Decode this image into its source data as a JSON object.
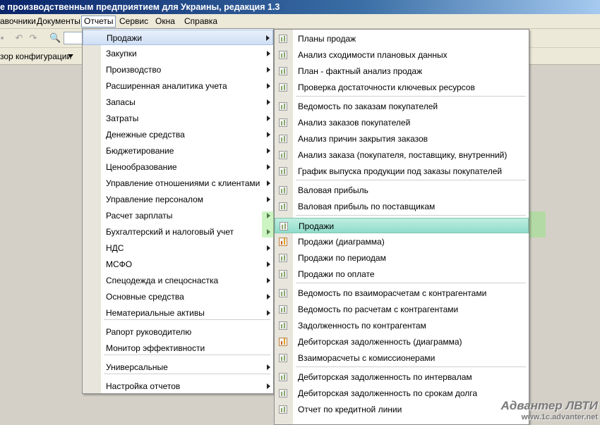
{
  "window": {
    "title": "е производственным предприятием для Украины, редакция 1.3"
  },
  "menubar": {
    "items": [
      "авочники",
      "Документы",
      "Отчеты",
      "Сервис",
      "Окна",
      "Справка"
    ],
    "active": "Отчеты"
  },
  "configbar": {
    "label": "зор конфигурации"
  },
  "reports_menu": {
    "items": [
      {
        "label": "Продажи",
        "submenu": true,
        "highlighted": true
      },
      {
        "label": "Закупки",
        "submenu": true
      },
      {
        "label": "Производство",
        "submenu": true
      },
      {
        "label": "Расширенная аналитика учета",
        "submenu": true
      },
      {
        "label": "Запасы",
        "submenu": true
      },
      {
        "label": "Затраты",
        "submenu": true
      },
      {
        "label": "Денежные средства",
        "submenu": true
      },
      {
        "label": "Бюджетирование",
        "submenu": true
      },
      {
        "label": "Ценообразование",
        "submenu": true
      },
      {
        "label": "Управление отношениями с клиентами",
        "submenu": true
      },
      {
        "label": "Управление персоналом",
        "submenu": true
      },
      {
        "label": "Расчет зарплаты",
        "submenu": true
      },
      {
        "label": "Бухгалтерский и налоговый учет",
        "submenu": true
      },
      {
        "label": "НДС",
        "submenu": true
      },
      {
        "label": "МСФО",
        "submenu": true
      },
      {
        "label": "Спецодежда и спецоснастка",
        "submenu": true
      },
      {
        "label": "Основные средства",
        "submenu": true
      },
      {
        "label": "Нематериальные активы",
        "submenu": true
      },
      {
        "label": "Рапорт руководителю",
        "submenu": false
      },
      {
        "label": "Монитор эффективности",
        "submenu": false
      },
      {
        "label": "Универсальные",
        "submenu": true
      },
      {
        "label": "Настройка отчетов",
        "submenu": true
      }
    ]
  },
  "sales_submenu": {
    "items": [
      {
        "label": "Планы продаж",
        "icon": "report-icon"
      },
      {
        "label": "Анализ сходимости плановых данных",
        "icon": "report-icon"
      },
      {
        "label": "План - фактный анализ продаж",
        "icon": "report-icon"
      },
      {
        "label": "Проверка достаточности ключевых ресурсов",
        "icon": "report-icon"
      },
      {
        "label": "Ведомость по заказам покупателей",
        "icon": "report-icon"
      },
      {
        "label": "Анализ заказов покупателей",
        "icon": "report-icon"
      },
      {
        "label": "Анализ причин закрытия заказов",
        "icon": "report-icon"
      },
      {
        "label": "Анализ заказа (покупателя, поставщику, внутренний)",
        "icon": "report-icon"
      },
      {
        "label": "График выпуска продукции под заказы покупателей",
        "icon": "report-icon"
      },
      {
        "label": "Валовая прибыль",
        "icon": "report-icon"
      },
      {
        "label": "Валовая прибыль по поставщикам",
        "icon": "report-icon"
      },
      {
        "label": "Продажи",
        "icon": "report-icon",
        "highlighted": true
      },
      {
        "label": "Продажи (диаграмма)",
        "icon": "chart-icon"
      },
      {
        "label": "Продажи по периодам",
        "icon": "report-icon"
      },
      {
        "label": "Продажи по оплате",
        "icon": "report-icon"
      },
      {
        "label": "Ведомость по взаиморасчетам с контрагентами",
        "icon": "report-icon"
      },
      {
        "label": "Ведомость по расчетам с контрагентами",
        "icon": "report-icon"
      },
      {
        "label": "Задолженность по контрагентам",
        "icon": "report-icon"
      },
      {
        "label": "Дебиторская задолженность (диаграмма)",
        "icon": "chart-icon"
      },
      {
        "label": "Взаиморасчеты с комиссионерами",
        "icon": "report-icon"
      },
      {
        "label": "Дебиторская задолженность по интервалам",
        "icon": "report-icon"
      },
      {
        "label": "Дебиторская задолженность по срокам долга",
        "icon": "report-icon"
      },
      {
        "label": "Отчет по кредитной линии",
        "icon": "report-icon"
      }
    ]
  },
  "watermark": {
    "line1": "Адвантер ЛВТИ",
    "line2": "www.1c.advanter.net"
  }
}
